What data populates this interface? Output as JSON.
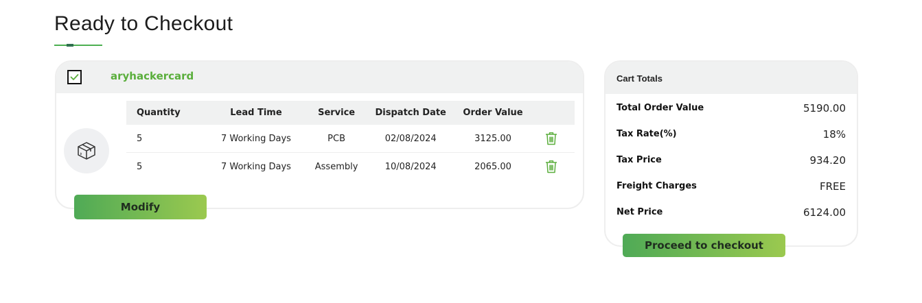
{
  "page": {
    "title": "Ready to Checkout"
  },
  "cart": {
    "name": "aryhackercard",
    "checked": true,
    "columns": [
      "Quantity",
      "Lead Time",
      "Service",
      "Dispatch Date",
      "Order Value"
    ],
    "rows": [
      {
        "quantity": "5",
        "lead_time": "7 Working Days",
        "service": "PCB",
        "dispatch_date": "02/08/2024",
        "order_value": "3125.00"
      },
      {
        "quantity": "5",
        "lead_time": "7 Working Days",
        "service": "Assembly",
        "dispatch_date": "10/08/2024",
        "order_value": "2065.00"
      }
    ],
    "modify_label": "Modify",
    "icons": {
      "product": "package-box-icon",
      "delete": "trash-icon",
      "checkbox": "checkmark-icon"
    }
  },
  "totals": {
    "title": "Cart Totals",
    "total_order_value": {
      "label": "Total Order Value",
      "value": "5190.00"
    },
    "tax_rate": {
      "label": "Tax Rate(%)",
      "value": "18%"
    },
    "tax_price": {
      "label": "Tax Price",
      "value": "934.20"
    },
    "freight": {
      "label": "Freight Charges",
      "value": "FREE"
    },
    "net_price": {
      "label": "Net Price",
      "value": "6124.00"
    },
    "checkout_label": "Proceed to checkout"
  },
  "colors": {
    "accent_green": "#5aae3c",
    "button_gradient_start": "#4faa56",
    "button_gradient_end": "#9bc94f",
    "header_bg": "#f0f1f1"
  }
}
